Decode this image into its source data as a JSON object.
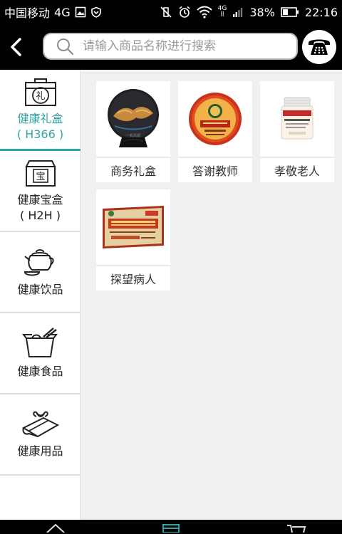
{
  "status_bar": {
    "carrier": "中国移动",
    "network": "4G",
    "network_small_top": "4G",
    "network_small_bottom": "ll",
    "battery": "38%",
    "time": "22:16"
  },
  "header": {
    "search_placeholder": "请输入商品名称进行搜索"
  },
  "sidebar": {
    "items": [
      {
        "label": "健康礼盒",
        "code": "( H366 )",
        "icon": "gift-box-li-icon",
        "active": true
      },
      {
        "label": "健康宝盒",
        "code": "( H2H )",
        "icon": "treasure-box-bao-icon",
        "active": false
      },
      {
        "label": "健康饮品",
        "code": "",
        "icon": "teapot-icon",
        "active": false
      },
      {
        "label": "健康食品",
        "code": "",
        "icon": "food-box-icon",
        "active": false
      },
      {
        "label": "健康用品",
        "code": "",
        "icon": "folded-towel-icon",
        "active": false
      }
    ]
  },
  "products": [
    {
      "label": "商务礼盒",
      "image": "tea-cake-on-stand"
    },
    {
      "label": "答谢教师",
      "image": "round-tea-cake-orange"
    },
    {
      "label": "孝敬老人",
      "image": "vitamin-jar"
    },
    {
      "label": "探望病人",
      "image": "ginseng-box"
    }
  ],
  "colors": {
    "accent": "#2fa6a6",
    "header_bg": "#000000",
    "page_bg": "#f0f0f0"
  }
}
